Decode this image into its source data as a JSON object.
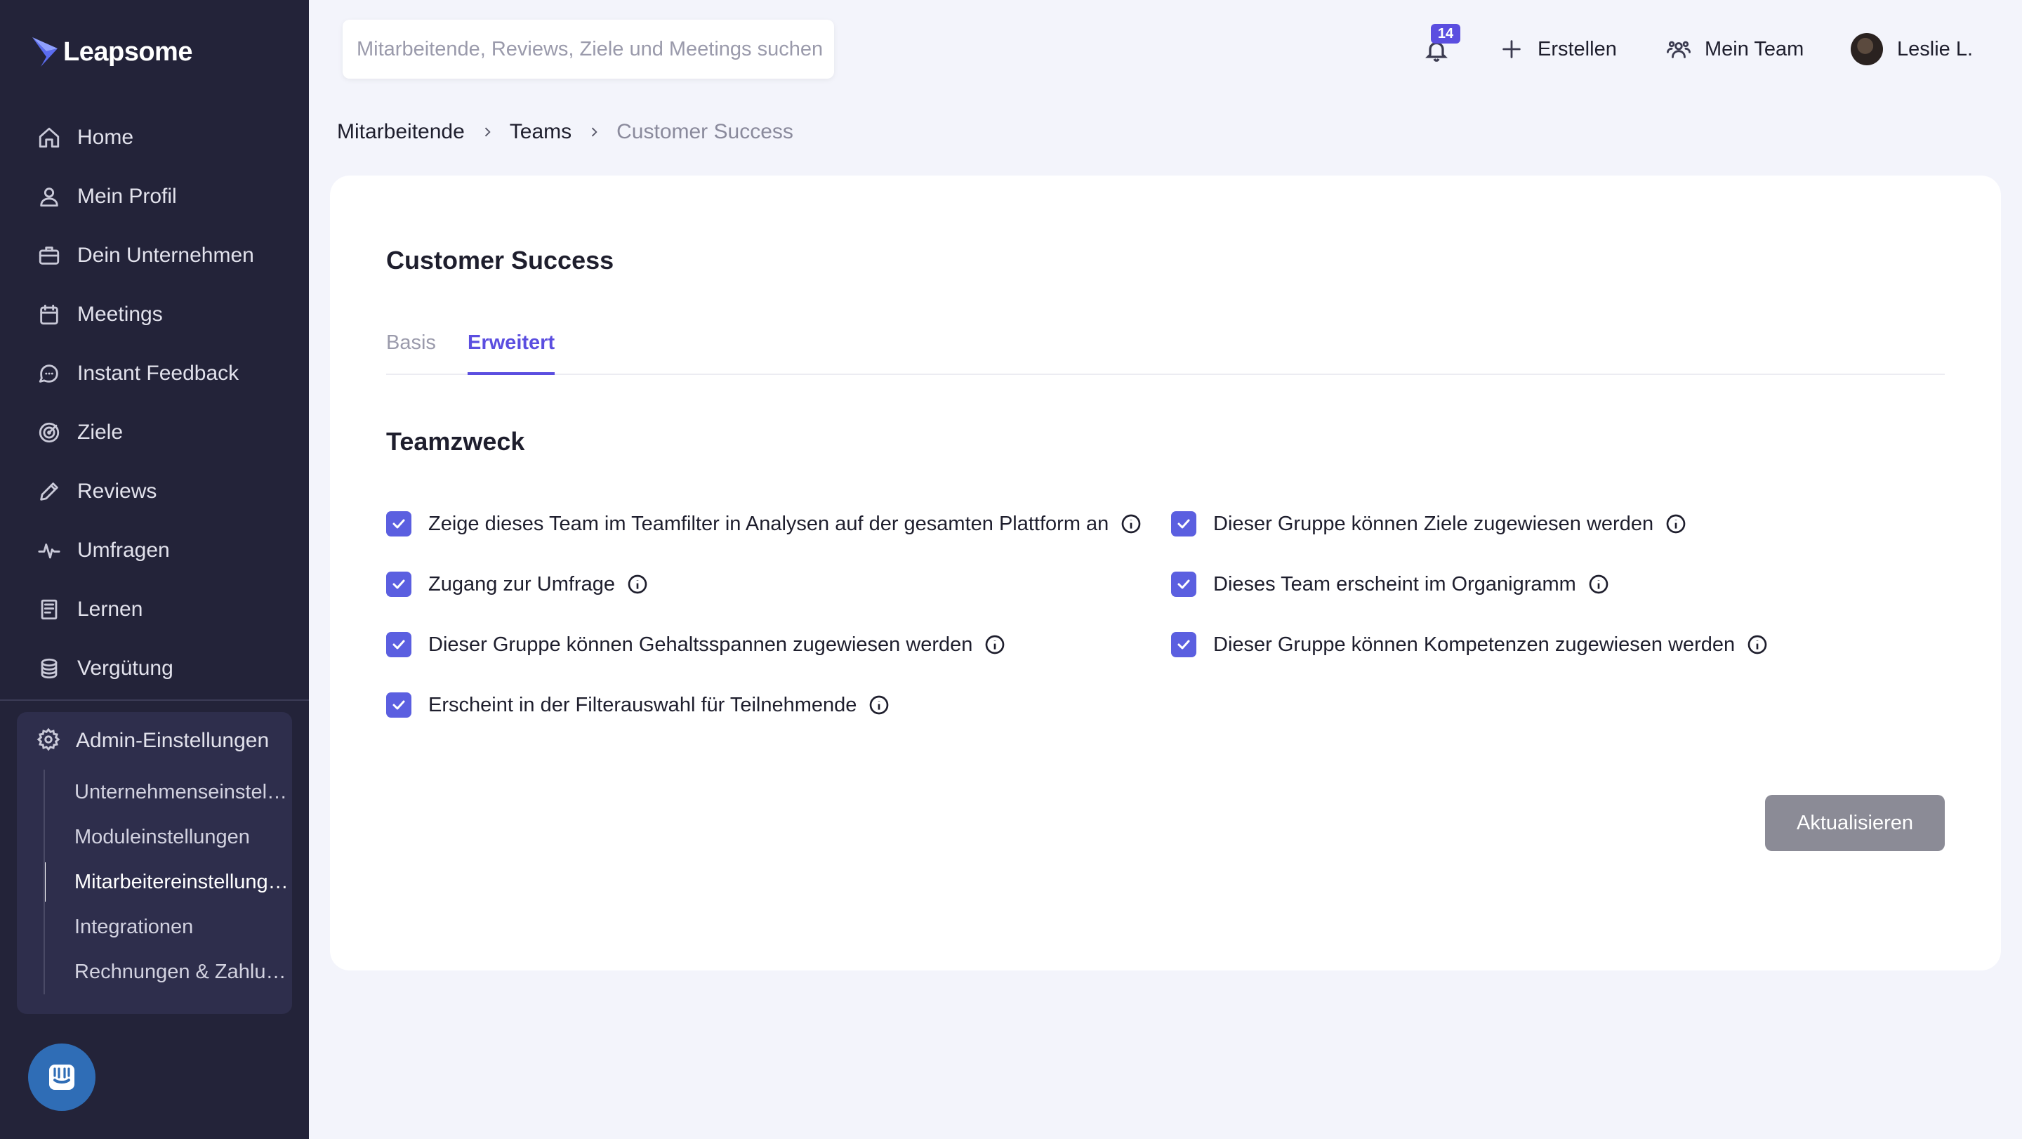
{
  "app": {
    "name": "Leapsome"
  },
  "sidebar": {
    "items": [
      {
        "label": "Home",
        "icon": "home-icon"
      },
      {
        "label": "Mein Profil",
        "icon": "user-icon"
      },
      {
        "label": "Dein Unternehmen",
        "icon": "briefcase-icon"
      },
      {
        "label": "Meetings",
        "icon": "calendar-icon"
      },
      {
        "label": "Instant Feedback",
        "icon": "chat-bubble-icon"
      },
      {
        "label": "Ziele",
        "icon": "target-icon"
      },
      {
        "label": "Reviews",
        "icon": "pencil-icon"
      },
      {
        "label": "Umfragen",
        "icon": "pulse-icon"
      },
      {
        "label": "Lernen",
        "icon": "book-icon"
      },
      {
        "label": "Vergütung",
        "icon": "coins-icon"
      }
    ],
    "admin": {
      "label": "Admin-Einstellungen",
      "icon": "gear-icon",
      "subitems": [
        {
          "label": "Unternehmenseinstellungen",
          "active": false
        },
        {
          "label": "Moduleinstellungen",
          "active": false
        },
        {
          "label": "Mitarbeitereinstellungen",
          "active": true
        },
        {
          "label": "Integrationen",
          "active": false
        },
        {
          "label": "Rechnungen & Zahlungen",
          "active": false
        }
      ]
    }
  },
  "topbar": {
    "search_placeholder": "Mitarbeitende, Reviews, Ziele und Meetings suchen",
    "notifications_count": "14",
    "create_label": "Erstellen",
    "team_label": "Mein Team",
    "user_name": "Leslie L."
  },
  "breadcrumb": [
    "Mitarbeitende",
    "Teams",
    "Customer Success"
  ],
  "card": {
    "title": "Customer Success",
    "tabs": [
      {
        "label": "Basis",
        "active": false
      },
      {
        "label": "Erweitert",
        "active": true
      }
    ],
    "section_title": "Teamzweck",
    "checkboxes_left": [
      {
        "label": "Zeige dieses Team im Teamfilter in Analysen auf der gesamten Plattform an",
        "checked": true
      },
      {
        "label": "Zugang zur Umfrage",
        "checked": true
      },
      {
        "label": "Dieser Gruppe können Gehaltsspannen zugewiesen werden",
        "checked": true
      },
      {
        "label": "Erscheint in der Filterauswahl für Teilnehmende",
        "checked": true
      }
    ],
    "checkboxes_right": [
      {
        "label": "Dieser Gruppe können Ziele zugewiesen werden",
        "checked": true
      },
      {
        "label": "Dieses Team erscheint im Organigramm",
        "checked": true
      },
      {
        "label": "Dieser Gruppe können Kompetenzen zugewiesen werden",
        "checked": true
      }
    ],
    "submit_label": "Aktualisieren"
  },
  "colors": {
    "sidebar_bg": "#232339",
    "accent": "#5b4ee0",
    "checkbox": "#5b5fe0",
    "disabled_button": "#8b8b96",
    "chat_button": "#2f6db6"
  }
}
